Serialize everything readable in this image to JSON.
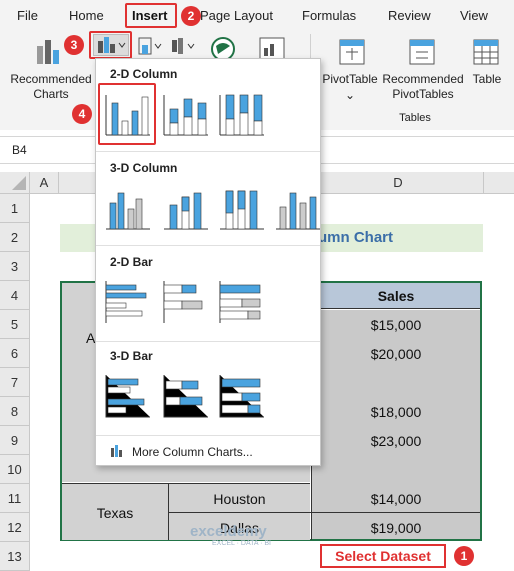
{
  "ribbon": {
    "tabs": [
      "File",
      "Home",
      "Insert",
      "Page Layout",
      "Formulas",
      "Review",
      "View"
    ],
    "recommended_charts": "Recommended Charts",
    "pivot_table": "PivotTable",
    "recommended_pivot": "Recommended PivotTables",
    "table": "Table",
    "tables_group": "Tables"
  },
  "formula_bar": {
    "name_box": "B4"
  },
  "columns": [
    "A",
    "D"
  ],
  "rows": [
    "1",
    "2",
    "3",
    "4",
    "5",
    "6",
    "7",
    "8",
    "9",
    "10",
    "11",
    "12",
    "13"
  ],
  "sheet": {
    "title_fragment": "umn Chart",
    "sales_header": "Sales",
    "a_fragment": "A",
    "sales_values": [
      "$15,000",
      "$20,000",
      "$18,000",
      "$23,000",
      "$14,000",
      "$19,000"
    ],
    "state_texas": "Texas",
    "city_houston": "Houston",
    "city_dallas": "Dallas"
  },
  "menu": {
    "section_2d_column": "2-D Column",
    "section_3d_column": "3-D Column",
    "section_2d_bar": "2-D Bar",
    "section_3d_bar": "3-D Bar",
    "more": "More Column Charts..."
  },
  "annotations": {
    "b1": "1",
    "b2": "2",
    "b3": "3",
    "b4": "4",
    "select_dataset": "Select Dataset",
    "watermark": "exceldemy",
    "watermark_sub": "EXCEL · DATA · BI"
  },
  "colors": {
    "accent_red": "#e03131",
    "chart_blue": "#4aa3df",
    "grid_green": "#217346"
  }
}
